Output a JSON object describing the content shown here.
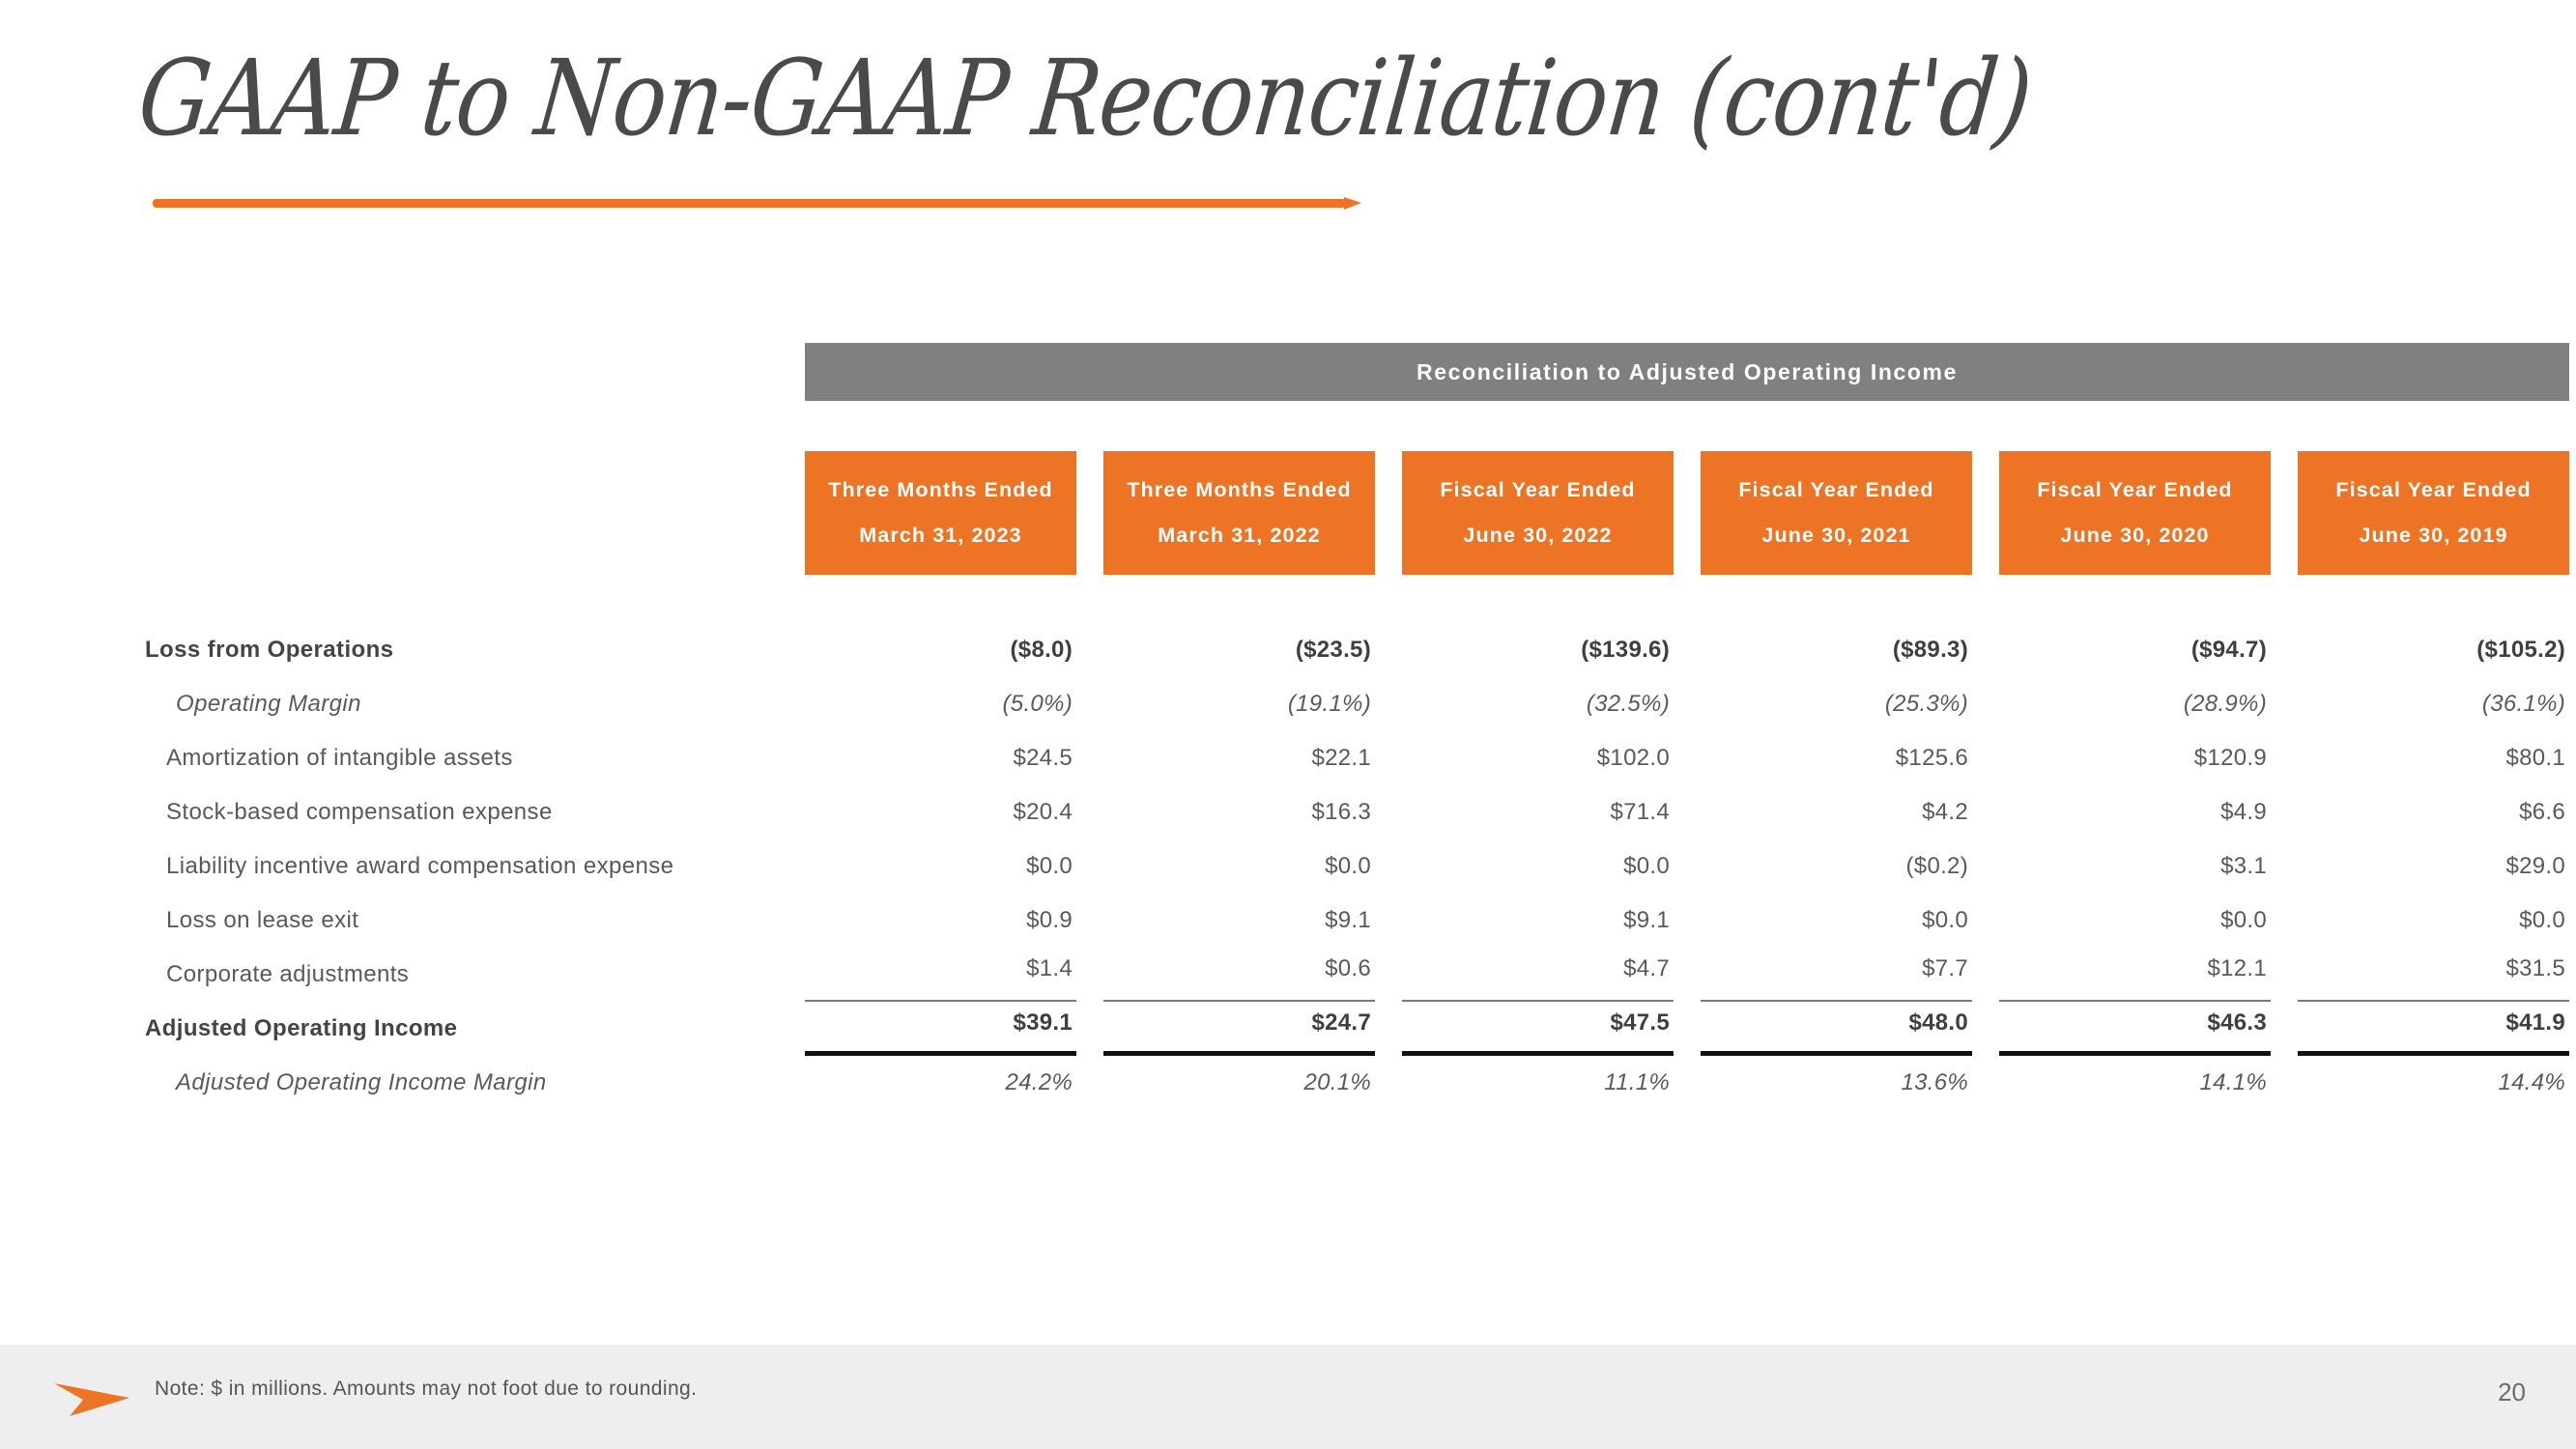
{
  "slide": {
    "title": "GAAP to Non-GAAP Reconciliation (cont'd)",
    "accent_color": "#ED7425",
    "header_bar_color": "#808080",
    "page_number": "20"
  },
  "table": {
    "group_header": "Reconciliation to Adjusted Operating Income",
    "columns": [
      {
        "line1": "Three Months Ended",
        "line2": "March 31, 2023"
      },
      {
        "line1": "Three Months Ended",
        "line2": "March 31, 2022"
      },
      {
        "line1": "Fiscal Year Ended",
        "line2": "June 30, 2022"
      },
      {
        "line1": "Fiscal Year Ended",
        "line2": "June 30, 2021"
      },
      {
        "line1": "Fiscal Year Ended",
        "line2": "June 30, 2020"
      },
      {
        "line1": "Fiscal Year Ended",
        "line2": "June 30, 2019"
      }
    ],
    "rows": [
      {
        "label": "Loss from Operations",
        "style": "bold",
        "values": [
          "($8.0)",
          "($23.5)",
          "($139.6)",
          "($89.3)",
          "($94.7)",
          "($105.2)"
        ]
      },
      {
        "label": "Operating Margin",
        "style": "italic",
        "values": [
          "(5.0%)",
          "(19.1%)",
          "(32.5%)",
          "(25.3%)",
          "(28.9%)",
          "(36.1%)"
        ]
      },
      {
        "label": "Amortization of intangible assets",
        "style": "indent",
        "values": [
          "$24.5",
          "$22.1",
          "$102.0",
          "$125.6",
          "$120.9",
          "$80.1"
        ]
      },
      {
        "label": "Stock-based compensation expense",
        "style": "indent",
        "values": [
          "$20.4",
          "$16.3",
          "$71.4",
          "$4.2",
          "$4.9",
          "$6.6"
        ]
      },
      {
        "label": "Liability incentive award compensation expense",
        "style": "indent",
        "values": [
          "$0.0",
          "$0.0",
          "$0.0",
          "($0.2)",
          "$3.1",
          "$29.0"
        ]
      },
      {
        "label": "Loss on lease exit",
        "style": "indent",
        "values": [
          "$0.9",
          "$9.1",
          "$9.1",
          "$0.0",
          "$0.0",
          "$0.0"
        ]
      },
      {
        "label": "Corporate adjustments",
        "style": "indent rule-thin",
        "values": [
          "$1.4",
          "$0.6",
          "$4.7",
          "$7.7",
          "$12.1",
          "$31.5"
        ]
      },
      {
        "label": "Adjusted Operating Income",
        "style": "bold total-row",
        "values": [
          "$39.1",
          "$24.7",
          "$47.5",
          "$48.0",
          "$46.3",
          "$41.9"
        ]
      },
      {
        "label": "Adjusted Operating Income Margin",
        "style": "italic",
        "values": [
          "24.2%",
          "20.1%",
          "11.1%",
          "13.6%",
          "14.1%",
          "14.4%"
        ]
      }
    ]
  },
  "footer": {
    "note": "Note: $ in millions. Amounts may not foot due to rounding.",
    "logo_icon": "orange-arrow-icon"
  }
}
